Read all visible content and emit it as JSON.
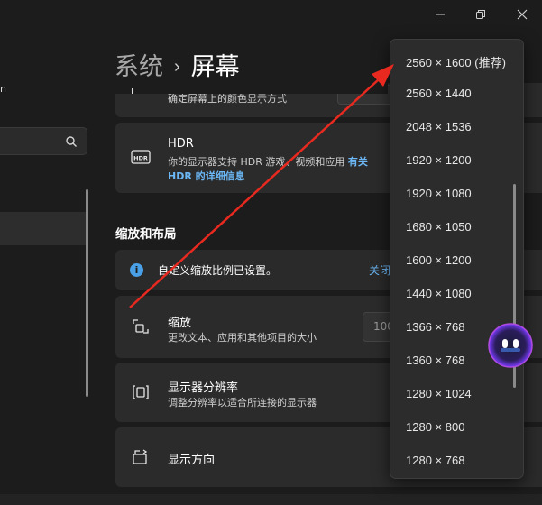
{
  "window": {
    "minimize_icon": "minimize-icon",
    "restore_icon": "restore-icon",
    "close_icon": "close-icon"
  },
  "nav": {
    "fragment_text": "n",
    "search_icon": "search-icon"
  },
  "breadcrumb": {
    "parent": "系统",
    "separator": "›",
    "current": "屏幕"
  },
  "cards": {
    "color_profile_sub": "确定屏幕上的颜色显示方式",
    "hdr": {
      "title": "HDR",
      "sub": "你的显示器支持 HDR 游戏、视频和应用",
      "link_inline": "有关",
      "link_line2": "HDR 的详细信息"
    },
    "section_title": "缩放和布局",
    "info": {
      "text": "自定义缩放比例已设置。",
      "link": "关闭"
    },
    "scale": {
      "title": "缩放",
      "sub": "更改文本、应用和其他项目的大小",
      "value_fragment": "100"
    },
    "resolution": {
      "title": "显示器分辨率",
      "sub": "调整分辨率以适合所连接的显示器"
    },
    "orientation": {
      "title": "显示方向"
    }
  },
  "resolution_dropdown": {
    "options": [
      "2560 × 1600 (推荐)",
      "2560 × 1440",
      "2048 × 1536",
      "1920 × 1200",
      "1920 × 1080",
      "1680 × 1050",
      "1600 × 1200",
      "1440 × 1080",
      "1366 × 768",
      "1360 × 768",
      "1280 × 1024",
      "1280 × 800",
      "1280 × 768"
    ]
  },
  "annotation": {
    "arrow_color": "#e8291f"
  },
  "colors": {
    "background": "#1c1c1c",
    "card": "#2b2b2b",
    "accent_link": "#6cb8f6",
    "info_icon": "#4aa0e6"
  }
}
